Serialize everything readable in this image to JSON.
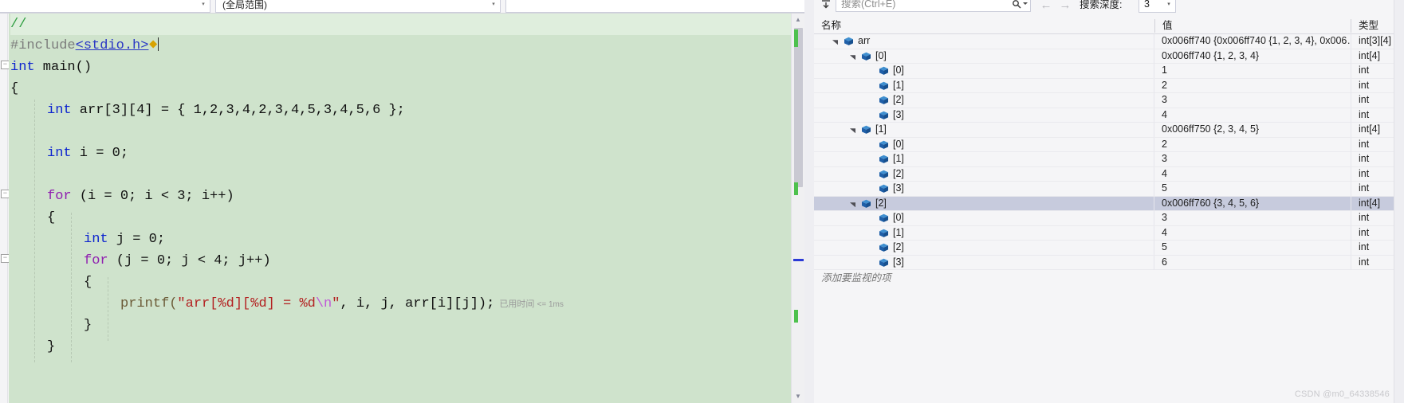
{
  "editor": {
    "nav_bar": {
      "project_combo_value": "",
      "scope_combo_value": "(全局范围)",
      "member_combo_value": "",
      "dropdown_glyph": "▾"
    },
    "elapsed_annotation": {
      "label": "已用时间",
      "value": "<= 1ms"
    },
    "quick_action_glyph": "⯁",
    "code_lines": [
      {
        "indent": 0,
        "tokens": [
          {
            "text": "//",
            "cls": "t-comment"
          }
        ]
      },
      {
        "indent": 0,
        "tokens": [
          {
            "text": "#include",
            "cls": "t-pp"
          },
          {
            "text": "<stdio.h>",
            "cls": "t-inc"
          }
        ]
      },
      {
        "indent": 0,
        "tokens": [
          {
            "text": "int",
            "cls": "t-kw"
          },
          {
            "text": " main()",
            "cls": "t-plain"
          }
        ]
      },
      {
        "indent": 0,
        "tokens": [
          {
            "text": "{",
            "cls": "t-plain"
          }
        ]
      },
      {
        "indent": 1,
        "tokens": [
          {
            "text": "int",
            "cls": "t-kw"
          },
          {
            "text": " arr[3][4] = { 1,2,3,4,2,3,4,5,3,4,5,6 };",
            "cls": "t-plain"
          }
        ]
      },
      {
        "indent": 1,
        "tokens": []
      },
      {
        "indent": 1,
        "tokens": [
          {
            "text": "int",
            "cls": "t-kw"
          },
          {
            "text": " i = 0;",
            "cls": "t-plain"
          }
        ]
      },
      {
        "indent": 1,
        "tokens": []
      },
      {
        "indent": 1,
        "tokens": [
          {
            "text": "for",
            "cls": "t-ctl"
          },
          {
            "text": " (i = 0; i < 3; i++)",
            "cls": "t-plain"
          }
        ]
      },
      {
        "indent": 1,
        "tokens": [
          {
            "text": "{",
            "cls": "t-plain"
          }
        ]
      },
      {
        "indent": 2,
        "tokens": [
          {
            "text": "int",
            "cls": "t-kw"
          },
          {
            "text": " j = 0;",
            "cls": "t-plain"
          }
        ]
      },
      {
        "indent": 2,
        "tokens": [
          {
            "text": "for",
            "cls": "t-ctl"
          },
          {
            "text": " (j = 0; j < 4; j++)",
            "cls": "t-plain"
          }
        ]
      },
      {
        "indent": 2,
        "tokens": [
          {
            "text": "{",
            "cls": "t-plain"
          }
        ]
      },
      {
        "indent": 3,
        "tokens": [
          {
            "text": "printf(",
            "cls": "t-fn"
          },
          {
            "text": "\"arr[%d][%d] = %d",
            "cls": "t-str"
          },
          {
            "text": "\\n",
            "cls": "t-esc"
          },
          {
            "text": "\"",
            "cls": "t-str"
          },
          {
            "text": ", i, j, arr[i][j]);",
            "cls": "t-plain"
          }
        ]
      },
      {
        "indent": 2,
        "tokens": [
          {
            "text": "}",
            "cls": "t-plain"
          }
        ]
      },
      {
        "indent": 1,
        "tokens": [
          {
            "text": "}",
            "cls": "t-plain"
          }
        ]
      }
    ],
    "scrollbar": {
      "up_glyph": "▲",
      "down_glyph": "▼"
    }
  },
  "watch": {
    "toolbar": {
      "search_placeholder": "搜索(Ctrl+E)",
      "search_value": "",
      "depth_label": "搜索深度:",
      "depth_value": "3",
      "prev_glyph": "←",
      "next_glyph": "→",
      "expand_glyph": "⤓",
      "dropdown_glyph": "▾"
    },
    "columns": [
      {
        "key": "name",
        "label": "名称"
      },
      {
        "key": "value",
        "label": "值"
      },
      {
        "key": "type",
        "label": "类型"
      }
    ],
    "add_item_placeholder": "添加要监视的项",
    "rows": [
      {
        "depth": 0,
        "expander": "expanded",
        "name": "arr",
        "value": "0x006ff740 {0x006ff740 {1, 2, 3, 4}, 0x006…",
        "type": "int[3][4]",
        "selected": false
      },
      {
        "depth": 1,
        "expander": "expanded",
        "name": "[0]",
        "value": "0x006ff740 {1, 2, 3, 4}",
        "type": "int[4]",
        "selected": false
      },
      {
        "depth": 2,
        "expander": "none",
        "name": "[0]",
        "value": "1",
        "type": "int",
        "selected": false
      },
      {
        "depth": 2,
        "expander": "none",
        "name": "[1]",
        "value": "2",
        "type": "int",
        "selected": false
      },
      {
        "depth": 2,
        "expander": "none",
        "name": "[2]",
        "value": "3",
        "type": "int",
        "selected": false
      },
      {
        "depth": 2,
        "expander": "none",
        "name": "[3]",
        "value": "4",
        "type": "int",
        "selected": false
      },
      {
        "depth": 1,
        "expander": "expanded",
        "name": "[1]",
        "value": "0x006ff750 {2, 3, 4, 5}",
        "type": "int[4]",
        "selected": false
      },
      {
        "depth": 2,
        "expander": "none",
        "name": "[0]",
        "value": "2",
        "type": "int",
        "selected": false
      },
      {
        "depth": 2,
        "expander": "none",
        "name": "[1]",
        "value": "3",
        "type": "int",
        "selected": false
      },
      {
        "depth": 2,
        "expander": "none",
        "name": "[2]",
        "value": "4",
        "type": "int",
        "selected": false
      },
      {
        "depth": 2,
        "expander": "none",
        "name": "[3]",
        "value": "5",
        "type": "int",
        "selected": false
      },
      {
        "depth": 1,
        "expander": "expanded",
        "name": "[2]",
        "value": "0x006ff760 {3, 4, 5, 6}",
        "type": "int[4]",
        "selected": true
      },
      {
        "depth": 2,
        "expander": "none",
        "name": "[0]",
        "value": "3",
        "type": "int",
        "selected": false
      },
      {
        "depth": 2,
        "expander": "none",
        "name": "[1]",
        "value": "4",
        "type": "int",
        "selected": false
      },
      {
        "depth": 2,
        "expander": "none",
        "name": "[2]",
        "value": "5",
        "type": "int",
        "selected": false
      },
      {
        "depth": 2,
        "expander": "none",
        "name": "[3]",
        "value": "6",
        "type": "int",
        "selected": false
      }
    ]
  },
  "watermark": "CSDN @m0_64338546",
  "colors": {
    "editor_background": "#cfe3cc",
    "current_line": "#dfeedd",
    "keyword": "#0d24cf",
    "control_keyword": "#9020b0",
    "comment": "#2f9e41",
    "string": "#b32121",
    "escape": "#c05ad8",
    "function": "#6b5a36",
    "include_link": "#2a37c4",
    "selection": "#c7cbdd",
    "panel_background": "#f5f5f7",
    "scroll_marker_green": "#4ec14e",
    "caret_marker_blue": "#2b3ad6"
  }
}
